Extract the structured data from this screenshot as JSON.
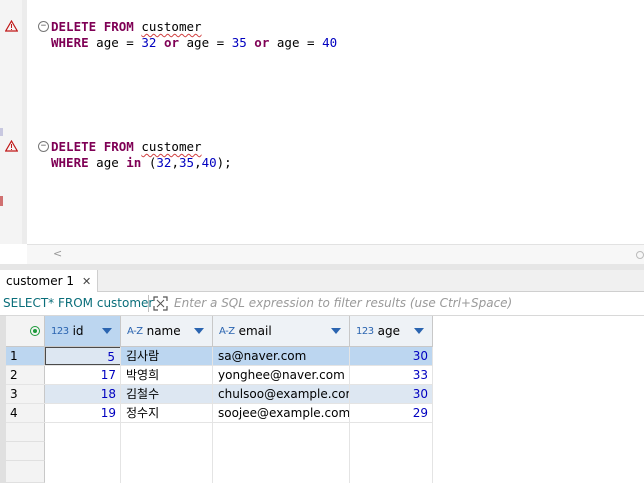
{
  "editor": {
    "query1": {
      "line1": {
        "kw1": "DELETE",
        "kw2": "FROM",
        "table": "customer"
      },
      "line2": {
        "kw1": "WHERE",
        "col1": "age",
        "op1": "=",
        "v1": "32",
        "or1": "or",
        "col2": "age",
        "op2": "=",
        "v2": "35",
        "or2": "or",
        "col3": "age",
        "op3": "=",
        "v3": "40"
      }
    },
    "query2": {
      "line1": {
        "kw1": "DELETE",
        "kw2": "FROM",
        "table": "customer"
      },
      "line2": {
        "kw1": "WHERE",
        "col": "age",
        "kw_in": "in",
        "open": "(",
        "v1": "32",
        "v2": "35",
        "v3": "40",
        "close": ");"
      }
    },
    "scroll_left": "<"
  },
  "results": {
    "tab_label": "customer 1",
    "tab_close": "✕",
    "query_text": "SELECT* FROM customer",
    "filter_placeholder": "Enter a SQL expression to filter results (use Ctrl+Space)",
    "columns": [
      {
        "type_icon": "123",
        "label": "id"
      },
      {
        "type_icon": "A-Z",
        "label": "name"
      },
      {
        "type_icon": "A-Z",
        "label": "email"
      },
      {
        "type_icon": "123",
        "label": "age"
      }
    ],
    "rows": [
      {
        "num": "1",
        "id": "5",
        "name": "김사람",
        "email": "sa@naver.com",
        "age": "30"
      },
      {
        "num": "2",
        "id": "17",
        "name": "박영희",
        "email": "yonghee@naver.com",
        "age": "33"
      },
      {
        "num": "3",
        "id": "18",
        "name": "김철수",
        "email": "chulsoo@example.com",
        "age": "30"
      },
      {
        "num": "4",
        "id": "19",
        "name": "정수지",
        "email": "soojee@example.com",
        "age": "29"
      }
    ]
  },
  "colors": {
    "keyword": "#7f0055",
    "number": "#0000c0",
    "accent": "#2a64b0",
    "selection": "#bcd6f0"
  }
}
